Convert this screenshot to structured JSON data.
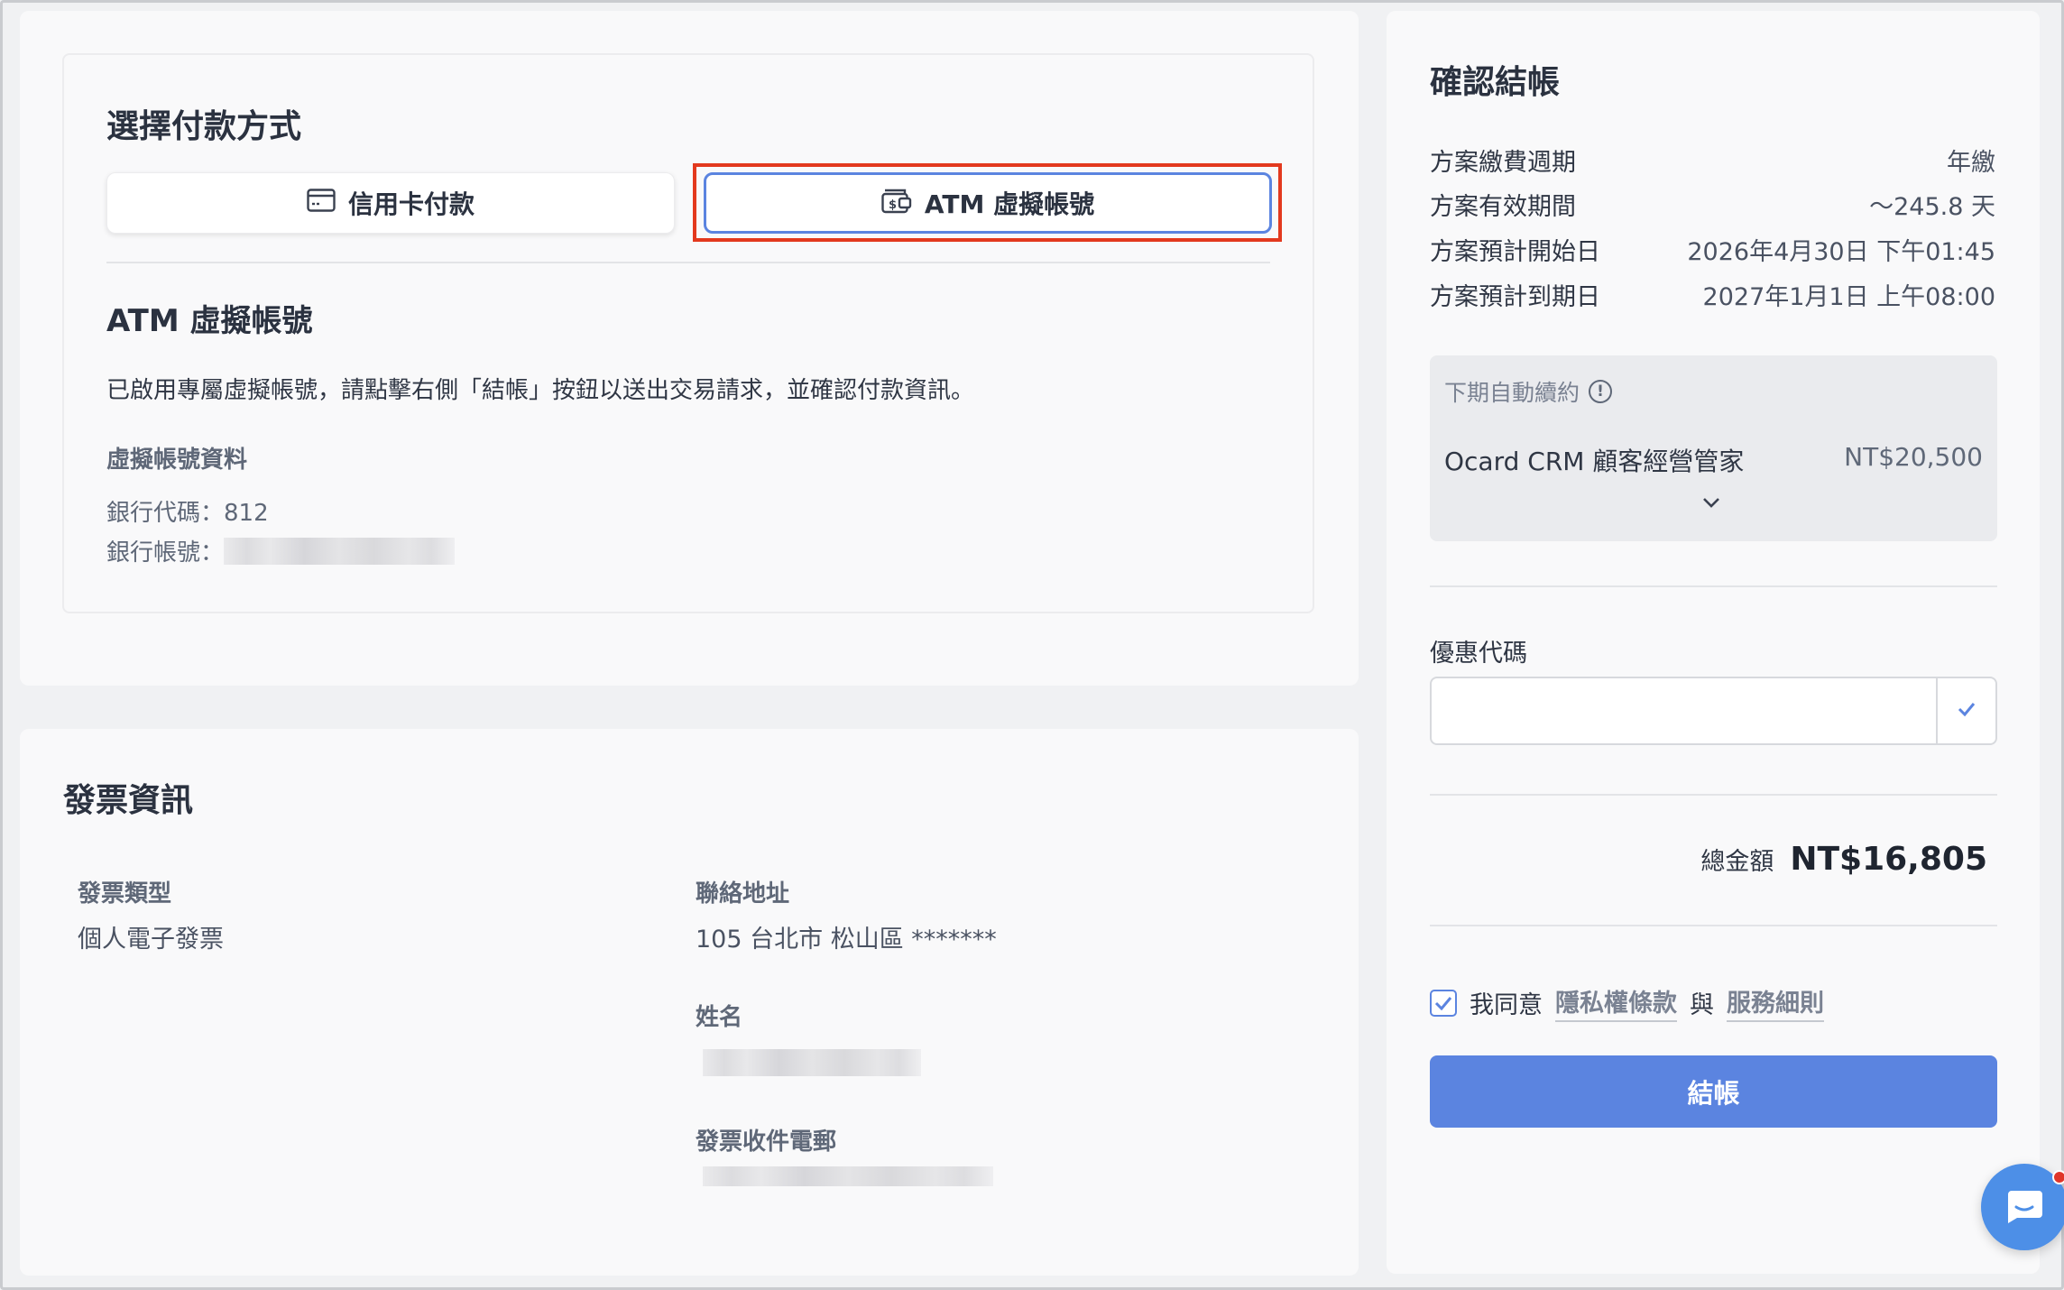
{
  "payment": {
    "title": "選擇付款方式",
    "methods": [
      {
        "label": "信用卡付款",
        "icon": "credit-card-icon",
        "selected": false
      },
      {
        "label": "ATM 虛擬帳號",
        "icon": "wallet-dollar-icon",
        "selected": true
      }
    ],
    "atm": {
      "title": "ATM 虛擬帳號",
      "description": "已啟用專屬虛擬帳號，請點擊右側「結帳」按鈕以送出交易請求，並確認付款資訊。",
      "info_heading": "虛擬帳號資料",
      "bank_code_label": "銀行代碼：812",
      "account_label": "銀行帳號："
    }
  },
  "invoice": {
    "title": "發票資訊",
    "type_label": "發票類型",
    "type_value": "個人電子發票",
    "address_label": "聯絡地址",
    "address_value": "105 台北市 松山區 *******",
    "name_label": "姓名",
    "email_label": "發票收件電郵"
  },
  "summary": {
    "title": "確認結帳",
    "rows": [
      {
        "key": "方案繳費週期",
        "value": "年繳"
      },
      {
        "key": "方案有效期間",
        "value": "～245.8 天"
      },
      {
        "key": "方案預計開始日",
        "value": "2026年4月30日 下午01:45"
      },
      {
        "key": "方案預計到期日",
        "value": "2027年1月1日 上午08:00"
      }
    ],
    "renewal": {
      "heading": "下期自動續約",
      "info_icon": "!",
      "item": "Ocard CRM 顧客經營管家",
      "price": "NT$20,500"
    },
    "coupon_label": "優惠代碼",
    "coupon_value": "",
    "total_label": "總金額",
    "total_amount": "NT$16,805",
    "agree_prefix": "我同意",
    "privacy_link": "隱私權條款",
    "agree_and": "與",
    "terms_link": "服務細則",
    "checkout_label": "結帳"
  },
  "colors": {
    "accent": "#5b84e0",
    "highlight": "#e3391e",
    "chat": "#4d8fe7"
  }
}
